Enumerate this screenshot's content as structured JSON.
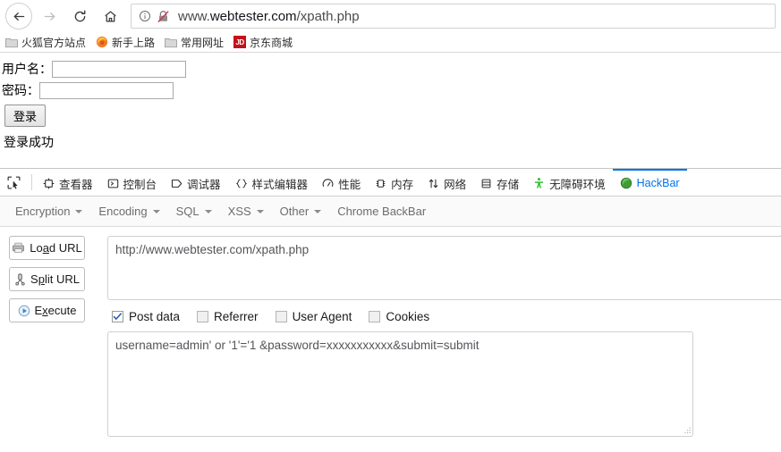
{
  "browser": {
    "nav": {
      "back_label": "Back",
      "forward_label": "Forward",
      "reload_label": "Reload",
      "home_label": "Home"
    },
    "urlbar": {
      "scheme_display": "www.",
      "host": "webtester.com",
      "path": "/xpath.php",
      "full_url": "www.webtester.com/xpath.php",
      "info_icon": "info-circle-icon",
      "security_icon": "lock-broken-icon"
    },
    "bookmarks": [
      {
        "label": "火狐官方站点",
        "icon": "folder-icon"
      },
      {
        "label": "新手上路",
        "icon": "firefox-icon"
      },
      {
        "label": "常用网址",
        "icon": "folder-icon"
      },
      {
        "label": "京东商城",
        "icon": "jd-icon",
        "icon_text": "JD"
      }
    ]
  },
  "page": {
    "username_label": "用户名：",
    "username_value": "",
    "username_placeholder": "",
    "password_label": "密码：",
    "password_value": "",
    "password_placeholder": "",
    "submit_label": "登录",
    "status_message": "登录成功"
  },
  "devtools": {
    "picker_icon": "element-picker-icon",
    "tabs": [
      {
        "label": "查看器",
        "icon": "inspector-icon",
        "active": false
      },
      {
        "label": "控制台",
        "icon": "console-icon",
        "active": false
      },
      {
        "label": "调试器",
        "icon": "debugger-icon",
        "active": false
      },
      {
        "label": "样式编辑器",
        "icon": "style-editor-icon",
        "active": false
      },
      {
        "label": "性能",
        "icon": "performance-icon",
        "active": false
      },
      {
        "label": "内存",
        "icon": "memory-icon",
        "active": false
      },
      {
        "label": "网络",
        "icon": "network-icon",
        "active": false
      },
      {
        "label": "存储",
        "icon": "storage-icon",
        "active": false
      },
      {
        "label": "无障碍环境",
        "icon": "accessibility-icon",
        "active": false
      },
      {
        "label": "HackBar",
        "icon": "hackbar-icon",
        "active": true
      }
    ],
    "active_tab_color": "#0074e8"
  },
  "hackbar": {
    "menus": [
      {
        "label": "Encryption",
        "has_caret": true
      },
      {
        "label": "Encoding",
        "has_caret": true
      },
      {
        "label": "SQL",
        "has_caret": true
      },
      {
        "label": "XSS",
        "has_caret": true
      },
      {
        "label": "Other",
        "has_caret": true
      },
      {
        "label": "Chrome BackBar",
        "has_caret": false
      }
    ],
    "buttons": [
      {
        "label_pre": "Lo",
        "accel": "a",
        "label_post": "d URL",
        "icon": "load-url-icon"
      },
      {
        "label_pre": "S",
        "accel": "p",
        "label_post": "lit URL",
        "icon": "split-url-icon"
      },
      {
        "label_pre": "E",
        "accel": "x",
        "label_post": "ecute",
        "icon": "execute-icon"
      }
    ],
    "url_value": "http://www.webtester.com/xpath.php",
    "url_placeholder": "",
    "checkboxes": [
      {
        "label": "Post data",
        "checked": true
      },
      {
        "label": "Referrer",
        "checked": false
      },
      {
        "label": "User Agent",
        "checked": false
      },
      {
        "label": "Cookies",
        "checked": false
      }
    ],
    "post_data_value": "username=admin' or '1'='1 &password=xxxxxxxxxxx&submit=submit",
    "post_data_placeholder": ""
  }
}
